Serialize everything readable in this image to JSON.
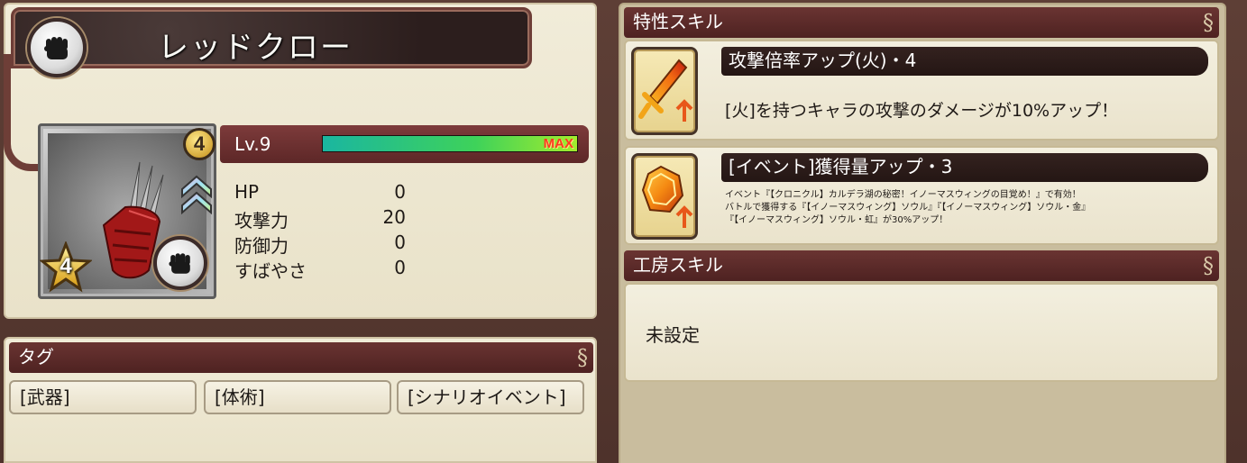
{
  "weapon": {
    "name": "レッドクロー",
    "level_badge": "4",
    "rank": "4",
    "weapon_type_icon": "fist-icon"
  },
  "level": {
    "label": "Lv.9",
    "exp_progress": 1.0,
    "max_label": "MAX"
  },
  "stats": [
    {
      "label": "HP",
      "value": "0"
    },
    {
      "label": "攻撃力",
      "value": "20"
    },
    {
      "label": "防御力",
      "value": "0"
    },
    {
      "label": "すばやさ",
      "value": "0"
    }
  ],
  "tags": {
    "header": "タグ",
    "items": [
      "[武器]",
      "[体術]",
      "[シナリオイベント]"
    ]
  },
  "trait_skills": {
    "header": "特性スキル",
    "items": [
      {
        "title": "攻撃倍率アップ(火)・4",
        "description": "[火]を持つキャラの攻撃のダメージが10%アップ！",
        "icon": "fire-sword-icon"
      },
      {
        "title": "[イベント]獲得量アップ・3",
        "description_lines": [
          "イベント『【クロニクル】カルデラ湖の秘密！イノーマスウィングの目覚め！』で有効！",
          "バトルで獲得する『【イノーマスウィング】ソウル』『【イノーマスウィング】ソウル・金』",
          "『【イノーマスウィング】ソウル・虹』が30%アップ！"
        ],
        "icon": "orange-gem-icon"
      }
    ]
  },
  "workshop_skills": {
    "header": "工房スキル",
    "value": "未設定"
  },
  "colors": {
    "header_bg": "#5b2a29",
    "panel_bg": "#ece6d0",
    "exp_green": "#3ed25a",
    "max_red": "#ff3a22"
  }
}
